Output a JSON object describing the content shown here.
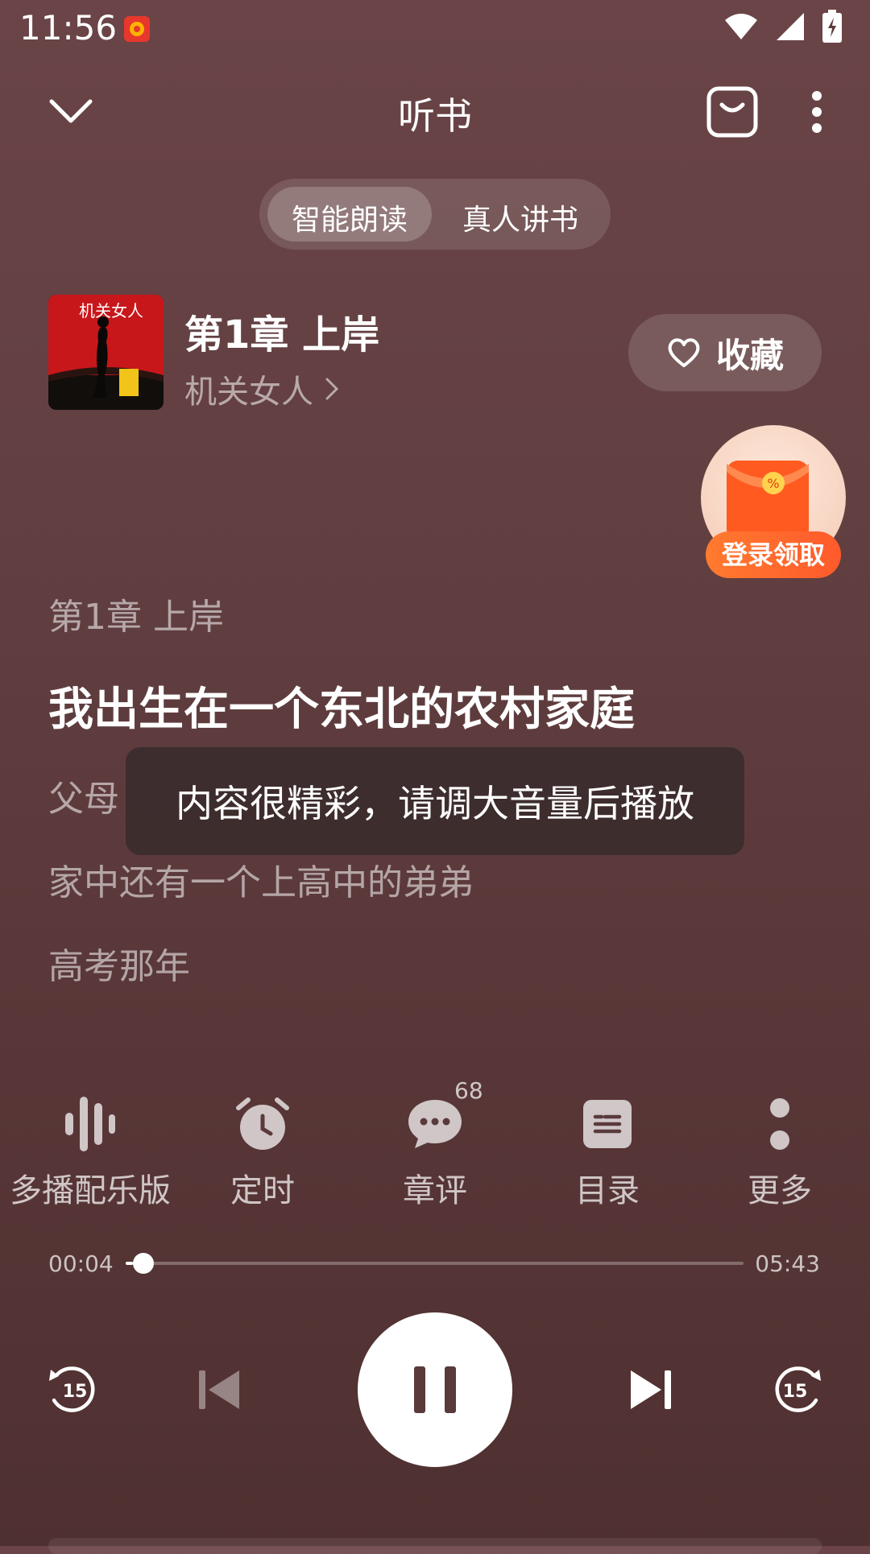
{
  "status_bar": {
    "time": "11:56"
  },
  "header": {
    "title": "听书"
  },
  "mode_toggle": {
    "options": [
      "智能朗读",
      "真人讲书"
    ],
    "selected": 0
  },
  "book": {
    "chapter_title": "第1章 上岸",
    "book_name": "机关女人",
    "cover_text": "机关女人",
    "favorite_label": "收藏"
  },
  "promo": {
    "label": "登录领取"
  },
  "reader": {
    "chapter_heading": "第1章 上岸",
    "current_line": "我出生在一个东北的农村家庭",
    "lines": [
      "父母",
      "家中还有一个上高中的弟弟",
      "高考那年"
    ]
  },
  "toast": {
    "message": "内容很精彩，请调大音量后播放"
  },
  "toolbar": {
    "items": [
      {
        "label": "多播配乐版",
        "icon": "waveform-icon"
      },
      {
        "label": "定时",
        "icon": "alarm-clock-icon"
      },
      {
        "label": "章评",
        "icon": "chat-bubble-icon",
        "badge": "68"
      },
      {
        "label": "目录",
        "icon": "catalog-icon"
      },
      {
        "label": "更多",
        "icon": "more-icon"
      }
    ]
  },
  "progress": {
    "elapsed": "00:04",
    "total": "05:43",
    "fraction": 0.012
  },
  "playback": {
    "rewind_seconds": "15",
    "forward_seconds": "15",
    "state": "playing"
  },
  "colors": {
    "accent": "#ffffff",
    "promo": "#ff6a2c",
    "background": "#603e40"
  }
}
